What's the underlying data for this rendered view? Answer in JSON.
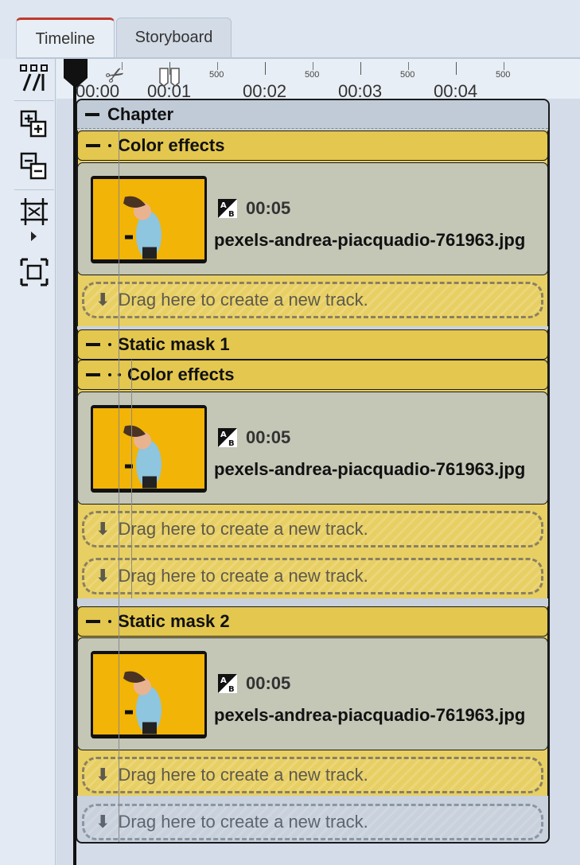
{
  "tabs": [
    {
      "label": "Timeline",
      "active": true
    },
    {
      "label": "Storyboard",
      "active": false
    }
  ],
  "toolbar": {
    "icons": [
      "align-tracks-icon",
      "add-track-icon",
      "remove-track-icon",
      "fit-timeline-icon",
      "zoom-fit-icon"
    ]
  },
  "ruler": {
    "time_labels": [
      "00:00",
      "00:01",
      "00:02",
      "00:03",
      "00:04"
    ],
    "sub_labels": [
      "500",
      "500",
      "500",
      "500"
    ]
  },
  "chapter": {
    "title": "Chapter",
    "groups": [
      {
        "title": "Color effects",
        "clip": {
          "duration": "00:05",
          "filename": "pexels-andrea-piacquadio-761963.jpg"
        },
        "drop_text": "Drag here to create a new track."
      },
      {
        "title": "Static mask 1",
        "inner_title": "Color effects",
        "clip": {
          "duration": "00:05",
          "filename": "pexels-andrea-piacquadio-761963.jpg"
        },
        "drop_text_inner": "Drag here to create a new track.",
        "drop_text": "Drag here to create a new track."
      },
      {
        "title": "Static mask 2",
        "clip": {
          "duration": "00:05",
          "filename": "pexels-andrea-piacquadio-761963.jpg"
        },
        "drop_text": "Drag here to create a new track."
      }
    ],
    "drop_text_chapter": "Drag here to create a new track."
  },
  "colors": {
    "accent_tab": "#c0392b",
    "track_yellow": "#e3c74f",
    "clip_bg": "#c4c6b6"
  }
}
